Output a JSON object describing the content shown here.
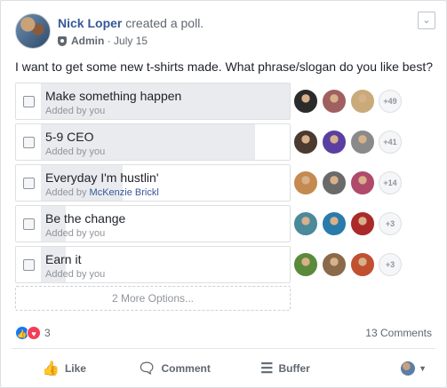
{
  "post": {
    "author": "Nick Loper",
    "action": "created a poll.",
    "role": "Admin",
    "date": "July 15",
    "role_icon": "shield-icon",
    "menu_icon": "chevron-down-icon",
    "question": "I want to get some new t-shirts made. What phrase/slogan do you like best?"
  },
  "poll": {
    "options": [
      {
        "label": "Make something happen",
        "added_prefix": "Added by",
        "added_by": "you",
        "vote_fraction": 1.0,
        "more_votes": "+49",
        "voter_colors": [
          "#2b2b2b",
          "#a06060",
          "#c9aa7a"
        ]
      },
      {
        "label": "5-9 CEO",
        "added_prefix": "Added by",
        "added_by": "you",
        "vote_fraction": 0.86,
        "more_votes": "+41",
        "voter_colors": [
          "#4a3a30",
          "#5a3fa0",
          "#8a8a8a"
        ]
      },
      {
        "label": "Everyday I'm hustlin'",
        "added_prefix": "Added by",
        "added_by": "McKenzie Brickl",
        "vote_fraction": 0.33,
        "more_votes": "+14",
        "voter_colors": [
          "#c48a50",
          "#6a6a6a",
          "#b04a6a"
        ]
      },
      {
        "label": "Be the change",
        "added_prefix": "Added by",
        "added_by": "you",
        "vote_fraction": 0.1,
        "more_votes": "+3",
        "voter_colors": [
          "#4a8a9a",
          "#2a7aaa",
          "#aa2a2a"
        ]
      },
      {
        "label": "Earn it",
        "added_prefix": "Added by",
        "added_by": "you",
        "vote_fraction": 0.1,
        "more_votes": "+3",
        "voter_colors": [
          "#5a8a3a",
          "#8a6a4a",
          "#c05030"
        ]
      }
    ],
    "more_options": "2 More Options..."
  },
  "stats": {
    "reaction_count": "3",
    "comments": "13 Comments",
    "like_icon": "thumbs-up-icon",
    "love_icon": "heart-icon"
  },
  "actions": {
    "like": "Like",
    "comment": "Comment",
    "buffer": "Buffer",
    "like_icon": "thumbs-up-icon",
    "comment_icon": "comment-bubble-icon",
    "buffer_icon": "buffer-stack-icon",
    "audience_icon": "caret-down-icon"
  },
  "colors": {
    "link": "#365899",
    "muted": "#90949c",
    "vote_bar": "#e9ebee",
    "like_blue": "#1877f2",
    "love_red": "#f33e58"
  }
}
